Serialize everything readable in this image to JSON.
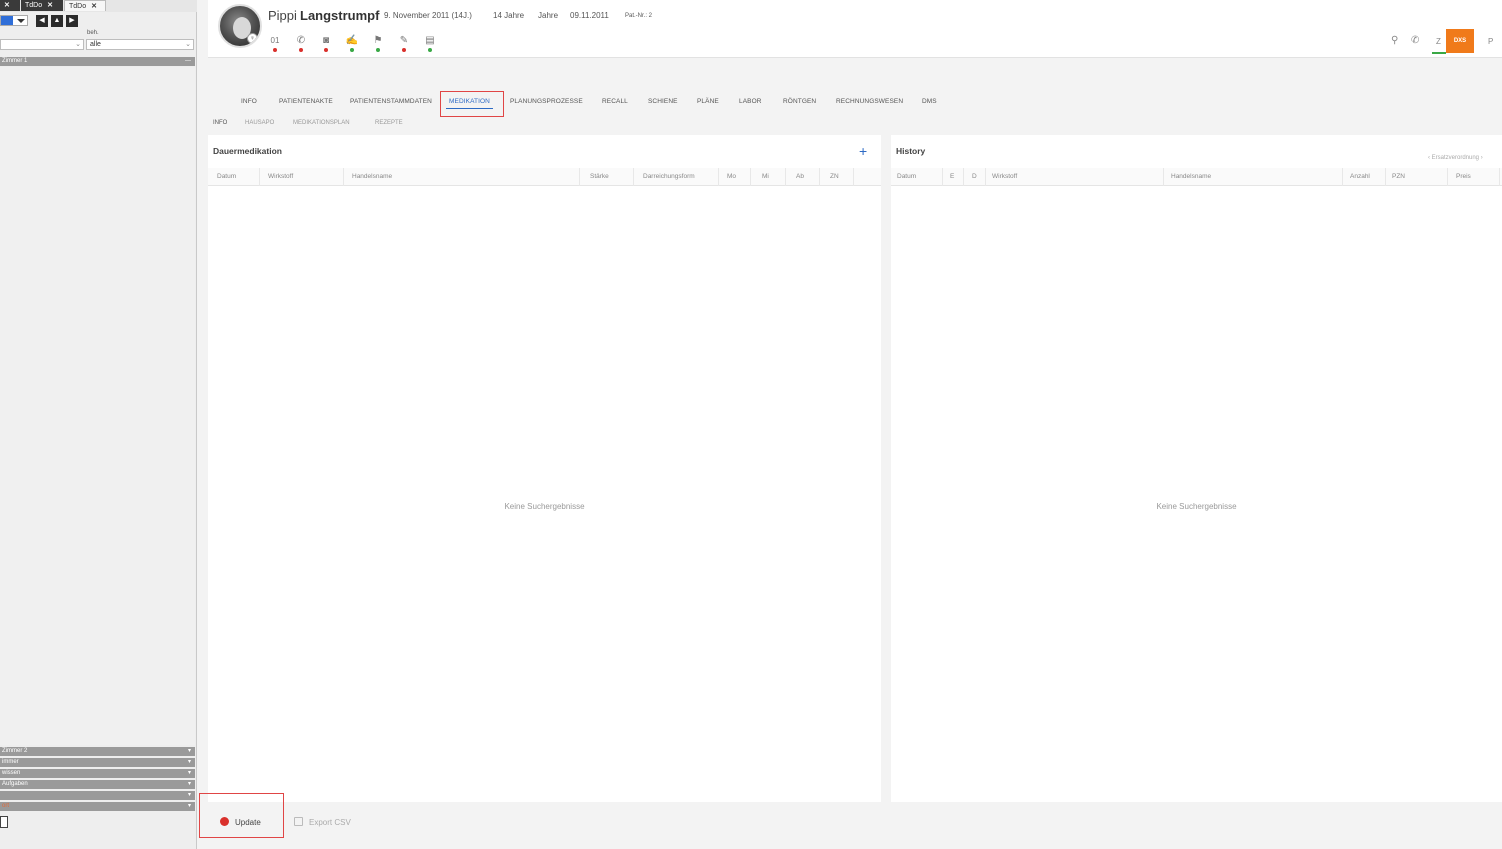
{
  "sidebar": {
    "tabs": [
      {
        "label": "",
        "close": "✕"
      },
      {
        "label": "TdDo",
        "close": "✕"
      },
      {
        "label": "TdDo",
        "close": "✕"
      }
    ],
    "filter_label": "beh.",
    "filter_value": "alle",
    "groups_top": [
      {
        "label": "Zimmer 1",
        "arrow": "—"
      }
    ],
    "groups_bottom": [
      {
        "label": "Zimmer 2",
        "arrow": "▾"
      },
      {
        "label": "immer",
        "arrow": "▾"
      },
      {
        "label": "wissen",
        "arrow": "▾"
      },
      {
        "label": "Aufgaben",
        "arrow": "▾"
      },
      {
        "label": "",
        "arrow": "▾"
      },
      {
        "label": "ort",
        "arrow": "▾"
      }
    ]
  },
  "patient": {
    "first_name": "Pippi",
    "last_name": "Langstrumpf",
    "birth_date": "9. November 2011 (14J.)",
    "age": "14 Jahre",
    "age_unit": "Jahre",
    "date": "09.11.2011",
    "pat_nr": "Pat.-Nr.: 2",
    "avatar_badge": "♀"
  },
  "header_icons": [
    {
      "name": "icon-01",
      "glyph": "01",
      "dot": "red"
    },
    {
      "name": "phone-icon",
      "glyph": "✆",
      "dot": "red"
    },
    {
      "name": "card-icon",
      "glyph": "◙",
      "dot": "red"
    },
    {
      "name": "signature-icon",
      "glyph": "✍",
      "dot": "green"
    },
    {
      "name": "flag-icon",
      "glyph": "⚑",
      "dot": "green"
    },
    {
      "name": "pen-icon",
      "glyph": "✎",
      "dot": "red"
    },
    {
      "name": "document-icon",
      "glyph": "▤",
      "dot": "green"
    }
  ],
  "header_right": {
    "pin_icon": "⚲",
    "phone_icon": "✆",
    "z_label": "Z",
    "orange_label": "DXS",
    "p_label": "P"
  },
  "tabs": [
    "INFO",
    "PATIENTENAKTE",
    "PATIENTENSTAMMDATEN",
    "MEDIKATION",
    "PLANUNGSPROZESSE",
    "RECALL",
    "SCHIENE",
    "PLÄNE",
    "LABOR",
    "RÖNTGEN",
    "RECHNUNGSWESEN",
    "DMS"
  ],
  "active_tab": "MEDIKATION",
  "subtabs": [
    "INFO",
    "HAUSAPO",
    "MEDIKATIONSPLAN",
    "REZEPTE"
  ],
  "dauermedikation": {
    "title": "Dauermedikation",
    "add_icon": "+",
    "columns": [
      "Datum",
      "Wirkstoff",
      "Handelsname",
      "Stärke",
      "Darreichungsform",
      "Mo",
      "Mi",
      "Ab",
      "ZN"
    ],
    "empty_text": "Keine Suchergebnisse"
  },
  "history": {
    "title": "History",
    "sort_label": "‹  Ersatzverordnung  ›",
    "columns": [
      "Datum",
      "E",
      "D",
      "Wirkstoff",
      "Handelsname",
      "Anzahl",
      "PZN",
      "Preis"
    ],
    "empty_text": "Keine Suchergebnisse"
  },
  "footer": {
    "update_label": "Update",
    "export_label": "Export CSV"
  },
  "colors": {
    "accent": "#2d6ac4",
    "orange": "#f07a1a",
    "highlight_border": "#e04545",
    "status_red": "#d9302c",
    "status_green": "#39a845"
  }
}
